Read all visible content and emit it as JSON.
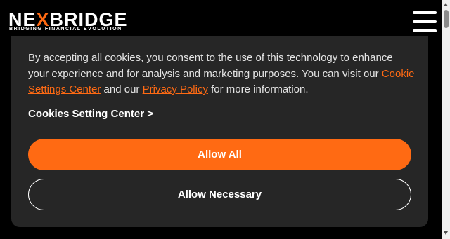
{
  "header": {
    "logo_part1": "NE",
    "logo_accent": "X",
    "logo_part2": "BRIDGE",
    "logo_tagline": "BRIDGING FINANCIAL EVOLUTION",
    "menu_icon": "hamburger-menu-icon"
  },
  "cookie_banner": {
    "text_before": "By accepting all cookies, you consent to the use of this technology to enhance your experience and for analysis and marketing purposes. You can visit our ",
    "cookie_settings_link": "Cookie Settings Center",
    "text_middle": " and our ",
    "privacy_policy_link": "Privacy Policy",
    "text_after": " for more information.",
    "settings_center_label": "Cookies Setting Center >",
    "allow_all_label": "Allow All",
    "allow_necessary_label": "Allow Necessary"
  },
  "colors": {
    "accent": "#ff6a13",
    "banner_bg": "#262626",
    "page_bg": "#000000"
  }
}
